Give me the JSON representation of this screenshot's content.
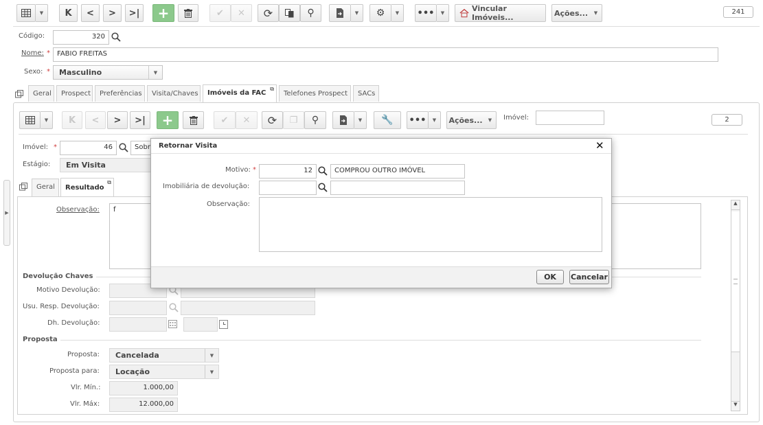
{
  "toolbar": {
    "vincular_label": "Vincular Imóveis...",
    "acoes_label": "Ações...",
    "record_count": "241"
  },
  "header": {
    "codigo_label": "Código:",
    "codigo_value": "320",
    "nome_label": "Nome:",
    "nome_value": "FABIO FREITAS",
    "sexo_label": "Sexo:",
    "sexo_value": "Masculino"
  },
  "tabs": [
    {
      "label": "Geral"
    },
    {
      "label": "Prospect"
    },
    {
      "label": "Preferências"
    },
    {
      "label": "Visita/Chaves"
    },
    {
      "label": "Imóveis da FAC"
    },
    {
      "label": "Telefones Prospect"
    },
    {
      "label": "SACs"
    }
  ],
  "sub_toolbar": {
    "acoes_label": "Ações...",
    "imovel_label": "Imóvel:",
    "imovel_value": "",
    "record_count": "2"
  },
  "detail": {
    "imovel_label": "Imóvel:",
    "imovel_value": "46",
    "imovel_desc": "Sobr",
    "estagio_label": "Estágio:",
    "estagio_value": "Em Visita"
  },
  "inner_tabs": [
    {
      "label": "Geral"
    },
    {
      "label": "Resultado"
    }
  ],
  "resultado": {
    "observacao_label": "Observação:",
    "observacao_value": "f",
    "devolucao_section": "Devolução Chaves",
    "motivo_devolucao_label": "Motivo Devolução:",
    "usu_resp_label": "Usu. Resp. Devolução:",
    "dh_devolucao_label": "Dh. Devolução:",
    "proposta_section": "Proposta",
    "proposta_label": "Proposta:",
    "proposta_value": "Cancelada",
    "proposta_para_label": "Proposta para:",
    "proposta_para_value": "Locação",
    "vlr_min_label": "Vlr. Mín.:",
    "vlr_min_value": "1.000,00",
    "vlr_max_label": "Vlr. Máx:",
    "vlr_max_value": "12.000,00"
  },
  "modal": {
    "title": "Retornar Visita",
    "motivo_label": "Motivo:",
    "motivo_code": "12",
    "motivo_desc": "COMPROU OUTRO IMÓVEL",
    "imobiliaria_label": "Imobiliária de devolução:",
    "imobiliaria_code": "",
    "imobiliaria_desc": "",
    "observacao_label": "Observação:",
    "observacao_value": "",
    "ok_label": "OK",
    "cancel_label": "Cancelar"
  }
}
